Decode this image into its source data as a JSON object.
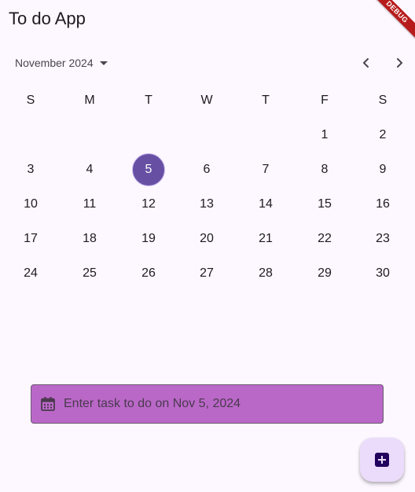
{
  "app": {
    "title": "To do App",
    "debug_label": "DEBUG"
  },
  "calendar": {
    "month_label": "November 2024",
    "weekdays": [
      "S",
      "M",
      "T",
      "W",
      "T",
      "F",
      "S"
    ],
    "selected_day": "5",
    "weeks": [
      [
        "",
        "",
        "",
        "",
        "",
        "1",
        "2"
      ],
      [
        "3",
        "4",
        "5",
        "6",
        "7",
        "8",
        "9"
      ],
      [
        "10",
        "11",
        "12",
        "13",
        "14",
        "15",
        "16"
      ],
      [
        "17",
        "18",
        "19",
        "20",
        "21",
        "22",
        "23"
      ],
      [
        "24",
        "25",
        "26",
        "27",
        "28",
        "29",
        "30"
      ]
    ]
  },
  "task_input": {
    "placeholder": "Enter task to do on Nov 5, 2024",
    "value": ""
  },
  "icons": {
    "month_dropdown": "arrow-drop-down-icon",
    "prev_month": "chevron-left-icon",
    "next_month": "chevron-right-icon",
    "task_field": "calendar-icon",
    "fab": "add-box-icon"
  },
  "colors": {
    "background": "#fdf7ff",
    "selected_day": "#6750a4",
    "task_field_fill": "#ba68c8",
    "fab_background": "#ebdcfb",
    "fab_icon": "#22005d",
    "debug_banner": "#b71c1c"
  }
}
